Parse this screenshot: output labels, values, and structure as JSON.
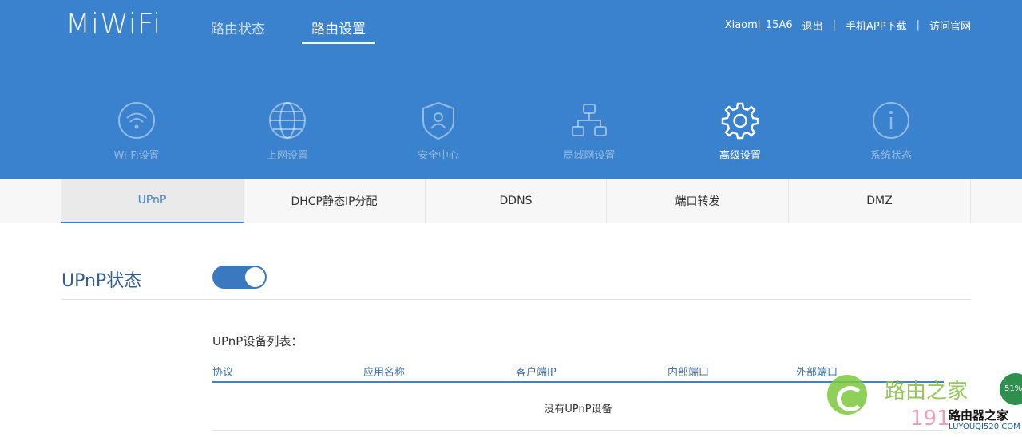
{
  "header": {
    "logo": "MiWiFi",
    "nav": [
      {
        "label": "路由状态",
        "active": false
      },
      {
        "label": "路由设置",
        "active": true
      }
    ],
    "user": "Xiaomi_15A6",
    "links": [
      "退出",
      "手机APP下载",
      "访问官网"
    ],
    "separator": "|"
  },
  "functions": [
    {
      "label": "Wi-Fi设置",
      "icon": "wifi-icon"
    },
    {
      "label": "上网设置",
      "icon": "globe-icon"
    },
    {
      "label": "安全中心",
      "icon": "shield-icon"
    },
    {
      "label": "局域网设置",
      "icon": "lan-icon"
    },
    {
      "label": "高级设置",
      "icon": "gear-icon",
      "active": true
    },
    {
      "label": "系统状态",
      "icon": "info-icon"
    }
  ],
  "subtabs": [
    {
      "label": "UPnP",
      "active": true
    },
    {
      "label": "DHCP静态IP分配"
    },
    {
      "label": "DDNS"
    },
    {
      "label": "端口转发"
    },
    {
      "label": "DMZ"
    }
  ],
  "upnp": {
    "title": "UPnP状态",
    "enabled": true,
    "list_title": "UPnP设备列表：",
    "columns": [
      "协议",
      "应用名称",
      "客户端IP",
      "内部端口",
      "外部端口"
    ],
    "empty": "没有UPnP设备"
  },
  "watermark": {
    "text_a": "路由之家",
    "text_b": "191",
    "text_c": "路由器之家",
    "text_d": "LUYOUQI520.COM",
    "badge": "51%"
  },
  "colors": {
    "header_bg": "#3a82cd",
    "accent": "#3a82cd",
    "toggle_on": "#3a79c0"
  }
}
